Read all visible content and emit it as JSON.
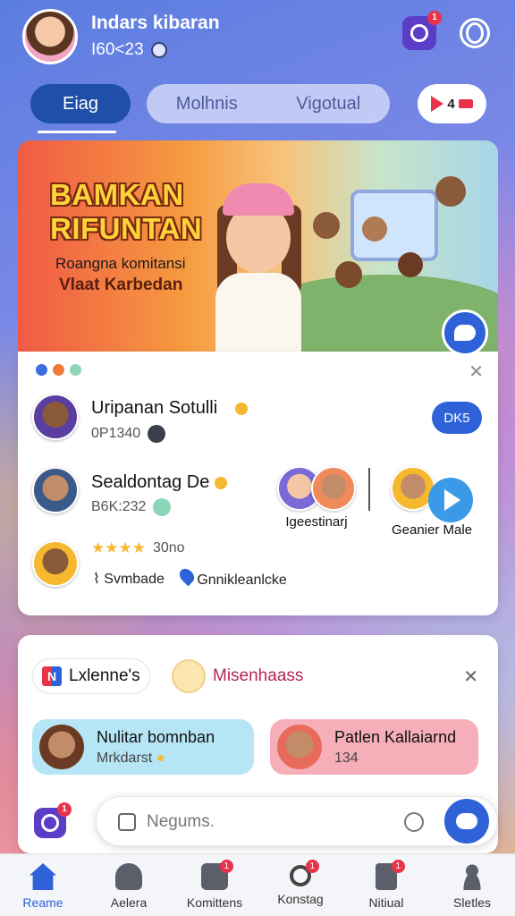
{
  "header": {
    "user_name": "Indars kibaran",
    "user_sub": "I60<23",
    "notif_count": "1"
  },
  "tabs": {
    "active": "Eiag",
    "group": [
      "Molhnis",
      "Vigotual"
    ],
    "live_count": "4"
  },
  "hero": {
    "title_line1": "BAMKAN",
    "title_line2": "RIFUNTAN",
    "subtitle": "Roangna komitansi",
    "tagline": "Vlaat Karbedan"
  },
  "feed": {
    "rows": [
      {
        "name": "Uripanan Sotulli",
        "sub": "0P1340"
      },
      {
        "name": "Sealdontag De",
        "sub": "B6K:232"
      }
    ],
    "action_button": "DK5",
    "stories": [
      {
        "label": "Igeestinarj"
      },
      {
        "label": "Geanier Male"
      }
    ],
    "rating_stars": "★★★★",
    "rating_count": "30no",
    "tags": [
      "Svmbade",
      "Gnnikleanlcke"
    ]
  },
  "lower": {
    "chip1": "Lxlenne's",
    "chip2": "Misenhaass",
    "suggestions": [
      {
        "title": "Nulitar bomnban",
        "sub": "Mrkdarst"
      },
      {
        "title": "Patlen Kallaiarnd",
        "sub": "134"
      }
    ]
  },
  "input": {
    "placeholder": "Negums."
  },
  "nav": {
    "items": [
      {
        "label": "Reame",
        "badge": ""
      },
      {
        "label": "Aelera",
        "badge": ""
      },
      {
        "label": "Komittens",
        "badge": "1"
      },
      {
        "label": "Konstag",
        "badge": "1"
      },
      {
        "label": "Nitiual",
        "badge": "1"
      },
      {
        "label": "Sletles",
        "badge": ""
      }
    ]
  },
  "colors": {
    "accent": "#2f62d8",
    "badge": "#e8334a"
  }
}
